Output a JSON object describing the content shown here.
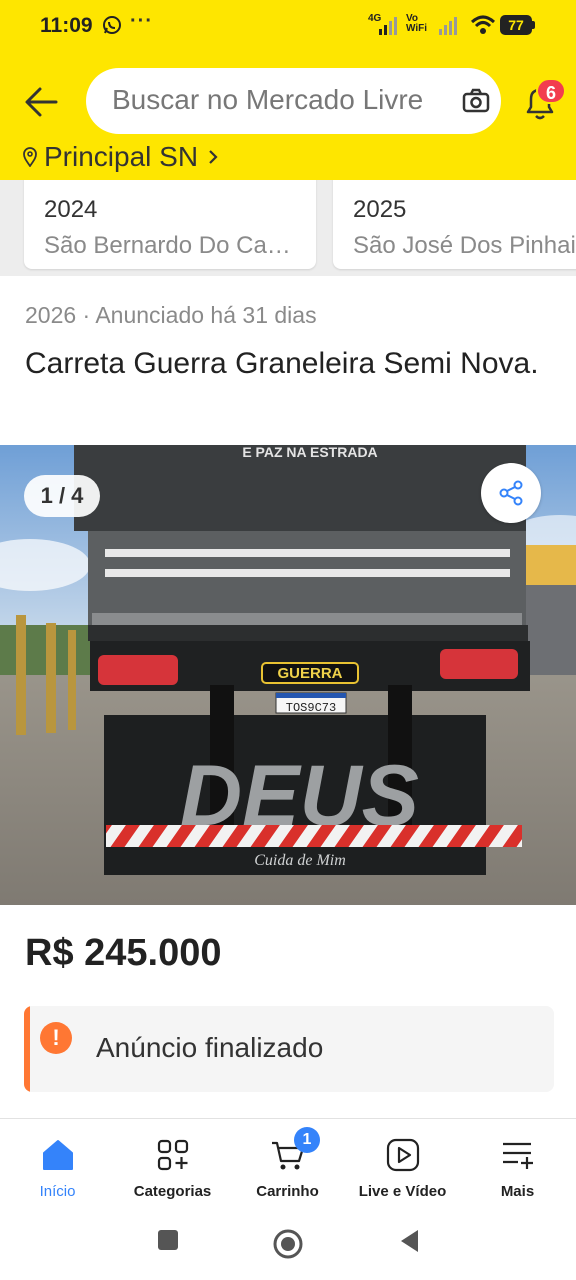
{
  "status_bar": {
    "time": "11:09",
    "dots": "···",
    "signal1_label": "4G",
    "signal2_label": "Vo WiFi",
    "battery": "77"
  },
  "search": {
    "placeholder": "Buscar no Mercado Livre",
    "notifications_count": "6"
  },
  "location": {
    "label": "Principal SN"
  },
  "related_cards": [
    {
      "year": "2024",
      "location": "São Bernardo Do Campo"
    },
    {
      "year": "2025",
      "location": "São José Dos Pinhais"
    }
  ],
  "listing": {
    "meta": "2026 · Anunciado há 31 dias",
    "title": "Carreta Guerra Graneleira Semi Nova.",
    "photo_counter": "1 / 4",
    "photo_texts": {
      "top_banner": "E PAZ NA ESTRADA",
      "brand_plate": "GUERRA",
      "license_plate": "TOS9C73",
      "mudflap": "DEUS",
      "mudflap_script": "Cuida de Mim"
    },
    "price": "R$ 245.000",
    "status": "Anúncio finalizado"
  },
  "bottom_nav": [
    {
      "label": "Início",
      "icon": "home-icon",
      "active": true
    },
    {
      "label": "Categorias",
      "icon": "categories-icon",
      "active": false
    },
    {
      "label": "Carrinho",
      "icon": "cart-icon",
      "active": false,
      "badge": "1"
    },
    {
      "label": "Live e Vídeo",
      "icon": "play-icon",
      "active": false
    },
    {
      "label": "Mais",
      "icon": "menu-plus-icon",
      "active": false
    }
  ],
  "colors": {
    "header_yellow": "#fee600",
    "accent_blue": "#3483fa",
    "warning_orange": "#ff7733",
    "badge_red": "#f23d4f"
  }
}
